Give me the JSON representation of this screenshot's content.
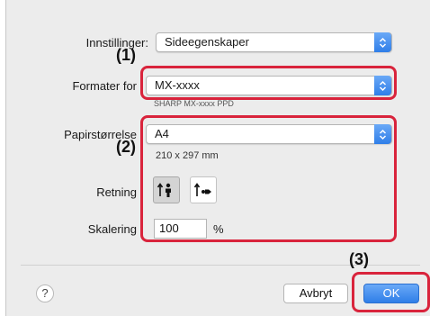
{
  "settings": {
    "label": "Innstillinger:",
    "value": "Sideegenskaper"
  },
  "format_for": {
    "label": "Formater for",
    "value": "MX-xxxx",
    "sub": "SHARP MX-xxxx PPD"
  },
  "paper": {
    "label": "Papirstørrelse",
    "value": "A4",
    "dimensions": "210 x 297 mm"
  },
  "orientation": {
    "label": "Retning",
    "options": [
      "portrait",
      "landscape"
    ],
    "selected": "portrait"
  },
  "scale": {
    "label": "Skalering",
    "value": "100",
    "unit": "%"
  },
  "buttons": {
    "help": "?",
    "cancel": "Avbryt",
    "ok": "OK"
  },
  "callouts": [
    "(1)",
    "(2)",
    "(3)"
  ],
  "colors": {
    "callout_border": "#d9243c",
    "accent": "#2f7ee8"
  },
  "icons": {
    "popup_arrows": "chevron-updown-icon",
    "portrait": "portrait-orientation-icon",
    "landscape": "landscape-orientation-icon",
    "help": "help-icon"
  }
}
